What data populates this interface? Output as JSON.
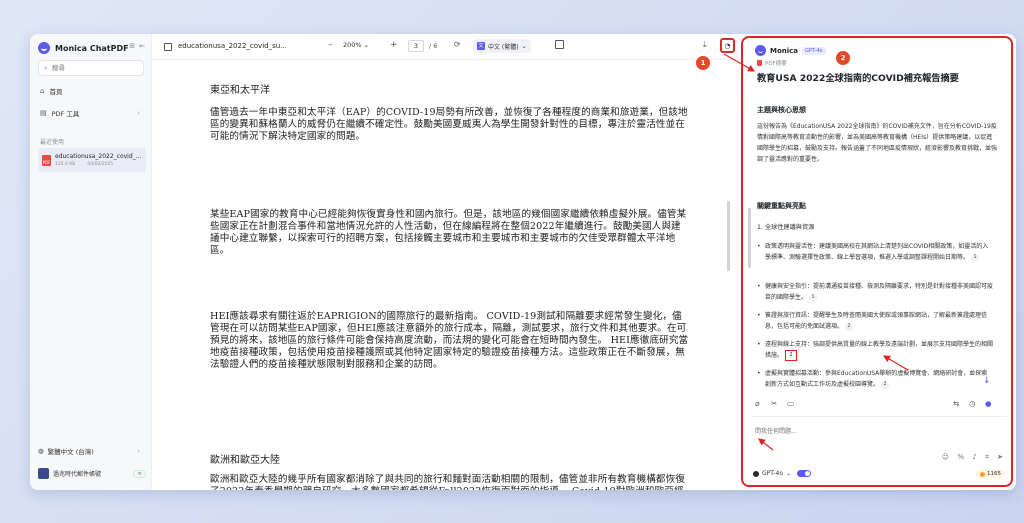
{
  "sidebar": {
    "brand": "Monica ChatPDF",
    "search_placeholder": "搜尋",
    "nav": [
      {
        "label": "首頁",
        "icon": "home-icon"
      },
      {
        "label": "PDF 工具",
        "icon": "pdf-tools-icon"
      }
    ],
    "recent_label": "最近使用",
    "recent_file": {
      "name": "educationusa_2022_covid_...",
      "size": "125.9 KB",
      "date": "04/02/2025"
    },
    "language": "繁體中文 (台灣)",
    "user": {
      "name": "過兆時代郵件帳號",
      "credits": "∞"
    }
  },
  "toolbar": {
    "filename": "educationusa_2022_covid_su...",
    "zoom": "200%",
    "page": "3",
    "page_total": "/ 6",
    "translate": "中文 (繁體)"
  },
  "document": {
    "heading1": "東亞和太平洋",
    "para1": "儘管過去一年中東亞和太平洋（EAP）的COVID-19局勢有所改善，並恢復了各種程度的商業和旅遊業，但該地區的變異和蘇格蘭人的威脅仍在繼續不確定性。鼓勵美國夏威夷人為學生開發針對性的目標，專注於靈活性並在可能的情況下解決特定國家的問題。",
    "para2": "某些EAP國家的教育中心已經能夠恢復實身性和國內旅行。但是，該地區的幾個國家繼續依賴虛擬外展。儘管某些國家正在計劃混合事件和當地情況允許的人性活動，但在線編程將在整個2022年繼續進行。鼓勵美國人與建議中心建立聯繫，以探索可行的招聘方案，包括接觸主要城市和主要城市和主要城市的欠佳受眾群體太平洋地區。",
    "para3": "HEI應該尋求有關往返於EAPRIGION的國際旅行的最新指南。 COVID-19測試和隔離要求經常發生變化，儘管現在可以訪問某些EAP國家，但HEI應該注意額外的旅行成本，隔離，測試要求，旅行文件和其他要求。在可預見的將來，該地區的旅行條件可能會保持高度流動，而法規的變化可能會在短時間內發生。 HEI應徹底研究當地疫苗接種政策，包括使用疫苗接種護照或其他特定國家特定的驗證疫苗接種方法。這些政策正在不斷發展，無法驗證人們的疫苗接種狀態限制對服務和企業的訪問。",
    "heading2": "歐洲和歐亞大陸",
    "para4": "歐洲和歐亞大陸的幾乎所有國家都消除了與共同的旅行和麵對面活動相關的限制，儘管並非所有教育機構都恢復了2022年春季學期的親自研究。大多數國家都希望從Fall2022恢復面對面的指導。 Covid-19對歐洲和歐亞經濟的長期經濟影響尚不清楚。儘管整個地區正在進行疫苗接種程序，但Insome國家的分佈仍然緩慢且不均勻，並且對疫苗安全和效率的懷疑仍然很高。"
  },
  "panel": {
    "assistant": "Monica",
    "model": "GPT-4o",
    "summary_label": "PDF摘要",
    "title": "教育USA 2022全球指南的COVID補充報告摘要",
    "section1": "主題與核心思想",
    "section1_text": "這份報告為《EducationUSA 2022全球指南》的COVID補充文件，旨在分析COVID-19疫情對國際高等教育流動性的影響，並為美國高等教育機構（HEIs）提供策略建議，以促進國際學生的招募，鼓勵及支持。報告涵蓋了不同地區疫情現狀，經濟影響及教育挑戰，並強調了靈活應對的重要性。",
    "section2": "關鍵重點與亮點",
    "sub1": "1. 全球性建議與資源",
    "bullets": [
      {
        "text": "政策透明與靈活性：建議美國高校在其網站上清楚列出COVID相關政策，如靈活的入學標準、測驗選擇性政策、線上學習選項，推遲入學或調整課程開始日期等。",
        "cite": "1"
      },
      {
        "text": "健康與安全指引：提前溝通疫苗接種、檢測及隔離要求，特別是針對接種非美國認可疫苗的國際學生。",
        "cite": "1"
      },
      {
        "text": "簽證與旅行資訊：提醒學生及時查閱美國大使館或領事館網站，了解最新簽證處理信息，包括可能的免面試選項。",
        "cite": "2"
      },
      {
        "text": "遠程與線上支持：強調提供高質量的線上教學及遠端計劃，並展示支持國際學生的相關措施。",
        "cite": "2"
      },
      {
        "text": "虛擬與實體招募活動：參與EducationUSA舉辦的虛擬博覽會、網絡研討會，並探索創新方式如互動式工作坊及虛擬校園導覽。",
        "cite": "2"
      }
    ],
    "input_placeholder": "問我任何問題...",
    "bottom_model": "GPT-4o",
    "credits": "1165"
  },
  "annotations": {
    "step1": "1",
    "step2": "2"
  },
  "colors": {
    "accent": "#5b5bf0",
    "highlight": "#e02424"
  }
}
